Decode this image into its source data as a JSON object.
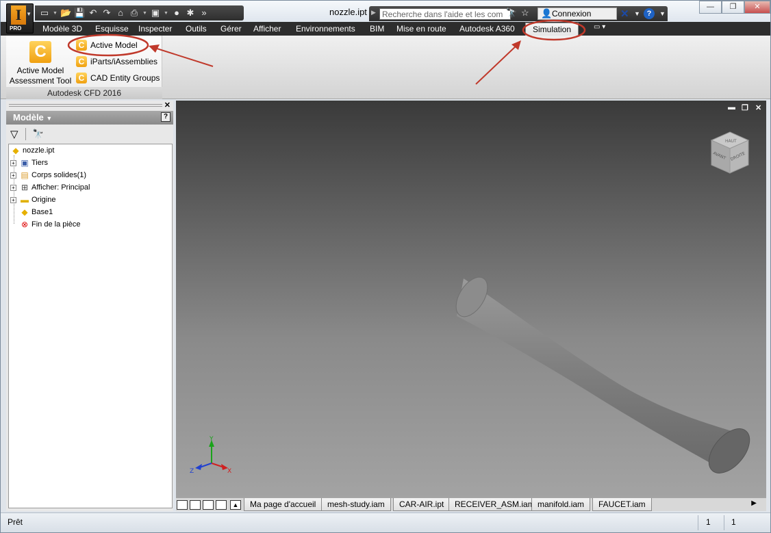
{
  "app": {
    "logo_letter": "I",
    "edition": "PRO",
    "document_title": "nozzle.ipt"
  },
  "quick_access": {
    "icons": [
      "new-icon",
      "open-icon",
      "save-icon",
      "undo-icon",
      "redo-icon",
      "home-icon",
      "print-icon",
      "material-icon",
      "appearance-icon",
      "adjust-icon",
      "more-icon"
    ]
  },
  "help": {
    "search_placeholder": "Recherche dans l'aide et les com",
    "login_label": "Connexion"
  },
  "ribbon_tabs": [
    {
      "label": "Modèle 3D"
    },
    {
      "label": "Esquisse"
    },
    {
      "label": "Inspecter"
    },
    {
      "label": "Outils"
    },
    {
      "label": "Gérer"
    },
    {
      "label": "Afficher"
    },
    {
      "label": "Environnements"
    },
    {
      "label": "BIM"
    },
    {
      "label": "Mise en route"
    },
    {
      "label": "Autodesk A360"
    },
    {
      "label": "Simulation",
      "active": true
    }
  ],
  "ribbon_panel": {
    "title": "Autodesk CFD 2016",
    "big_tool": {
      "line1": "Active Model",
      "line2": "Assessment Tool"
    },
    "small_tools": [
      {
        "label": "Active Model"
      },
      {
        "label": "iParts/iAssemblies"
      },
      {
        "label": "CAD Entity Groups"
      }
    ]
  },
  "browser": {
    "title": "Modèle",
    "help_glyph": "?",
    "tree": [
      {
        "label": "nozzle.ipt",
        "icon": "part-icon",
        "expandable": false
      },
      {
        "label": "Tiers",
        "icon": "third-party-icon",
        "expandable": true
      },
      {
        "label": "Corps solides(1)",
        "icon": "solid-bodies-icon",
        "expandable": true
      },
      {
        "label": "Afficher: Principal",
        "icon": "view-rep-icon",
        "expandable": true
      },
      {
        "label": "Origine",
        "icon": "folder-icon",
        "expandable": true
      },
      {
        "label": "Base1",
        "icon": "extrusion-icon",
        "expandable": false
      },
      {
        "label": "Fin de la pièce",
        "icon": "end-of-part-icon",
        "expandable": false
      }
    ]
  },
  "viewcube": {
    "top_face": "HAUT",
    "left_face": "AVANT",
    "right_face": "DROITE"
  },
  "triad": {
    "x": "X",
    "y": "Y",
    "z": "Z"
  },
  "document_tabs": [
    {
      "label": "Ma page d'accueil"
    },
    {
      "label": "mesh-study.iam"
    },
    {
      "label": "CAR-AIR.ipt"
    },
    {
      "label": "RECEIVER_ASM.iam"
    },
    {
      "label": "manifold.iam"
    },
    {
      "label": "FAUCET.iam"
    }
  ],
  "status": {
    "text": "Prêt",
    "count_a": "1",
    "count_b": "1"
  },
  "colors": {
    "annotation": "#c0392b",
    "accent": "#f0a010",
    "viewport_top": "#3a3a3a",
    "viewport_bottom": "#a3a3a3",
    "model_fill": "#8a8a8a"
  }
}
